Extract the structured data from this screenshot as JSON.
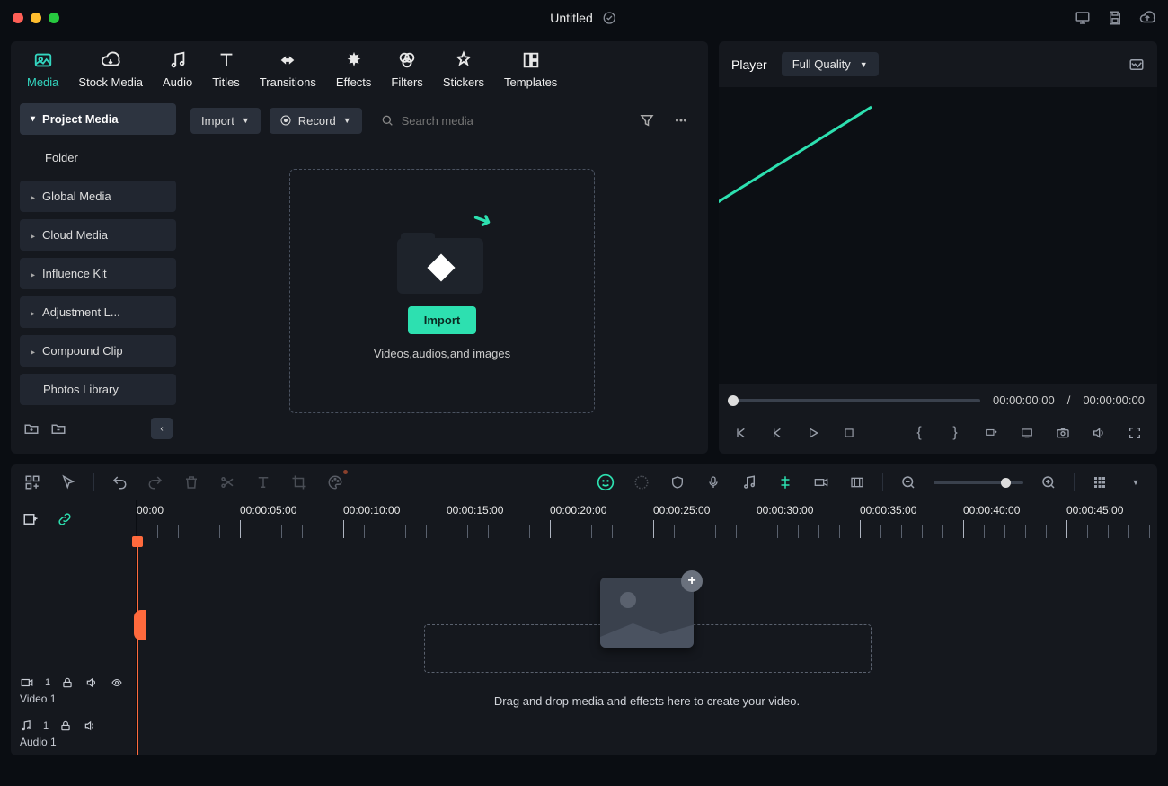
{
  "window": {
    "title": "Untitled"
  },
  "header_icons": [
    "monitor-icon",
    "save-icon",
    "cloud-upload-icon"
  ],
  "tabs": [
    {
      "id": "media",
      "label": "Media",
      "active": true
    },
    {
      "id": "stock",
      "label": "Stock Media"
    },
    {
      "id": "audio",
      "label": "Audio"
    },
    {
      "id": "titles",
      "label": "Titles"
    },
    {
      "id": "transitions",
      "label": "Transitions"
    },
    {
      "id": "effects",
      "label": "Effects"
    },
    {
      "id": "filters",
      "label": "Filters"
    },
    {
      "id": "stickers",
      "label": "Stickers"
    },
    {
      "id": "templates",
      "label": "Templates"
    }
  ],
  "sidebar": {
    "items": [
      {
        "label": "Project Media",
        "expanded": true,
        "active": true
      },
      {
        "label": "Folder",
        "sub": true
      },
      {
        "label": "Global Media"
      },
      {
        "label": "Cloud Media"
      },
      {
        "label": "Influence Kit"
      },
      {
        "label": "Adjustment L..."
      },
      {
        "label": "Compound Clip"
      },
      {
        "label": "Photos Library",
        "no_chevron": true
      }
    ]
  },
  "media_toolbar": {
    "import_label": "Import",
    "record_label": "Record",
    "search_placeholder": "Search media"
  },
  "dropzone": {
    "button_label": "Import",
    "hint": "Videos,audios,and images"
  },
  "player": {
    "label": "Player",
    "quality": "Full Quality",
    "current_time": "00:00:00:00",
    "separator": "/",
    "total_time": "00:00:00:00"
  },
  "timeline": {
    "ruler_marks": [
      "00:00",
      "00:00:05:00",
      "00:00:10:00",
      "00:00:15:00",
      "00:00:20:00",
      "00:00:25:00",
      "00:00:30:00",
      "00:00:35:00",
      "00:00:40:00",
      "00:00:45:00"
    ],
    "tracks": [
      {
        "id": "video1",
        "label": "Video 1",
        "badge": "1"
      },
      {
        "id": "audio1",
        "label": "Audio 1",
        "badge": "1"
      }
    ],
    "drop_text": "Drag and drop media and effects here to create your video."
  },
  "annotation": {
    "color": "#2de0b0"
  }
}
